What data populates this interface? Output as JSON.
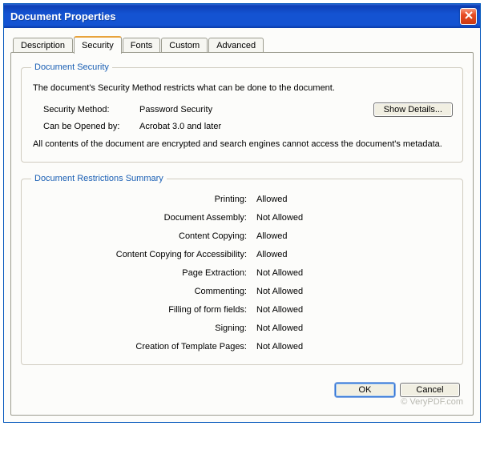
{
  "window": {
    "title": "Document Properties"
  },
  "tabs": {
    "description": "Description",
    "security": "Security",
    "fonts": "Fonts",
    "custom": "Custom",
    "advanced": "Advanced"
  },
  "security": {
    "legend": "Document Security",
    "intro": "The document's Security Method restricts what can be done to the document.",
    "method_label": "Security Method:",
    "method_value": "Password Security",
    "show_details": "Show Details...",
    "opened_label": "Can be Opened by:",
    "opened_value": "Acrobat 3.0 and later",
    "note": "All contents of the document are encrypted and search engines cannot access the document's metadata."
  },
  "restrictions": {
    "legend": "Document Restrictions Summary",
    "items": [
      {
        "label": "Printing:",
        "value": "Allowed"
      },
      {
        "label": "Document Assembly:",
        "value": "Not Allowed"
      },
      {
        "label": "Content Copying:",
        "value": "Allowed"
      },
      {
        "label": "Content Copying for Accessibility:",
        "value": "Allowed"
      },
      {
        "label": "Page Extraction:",
        "value": "Not Allowed"
      },
      {
        "label": "Commenting:",
        "value": "Not Allowed"
      },
      {
        "label": "Filling of form fields:",
        "value": "Not Allowed"
      },
      {
        "label": "Signing:",
        "value": "Not Allowed"
      },
      {
        "label": "Creation of Template Pages:",
        "value": "Not Allowed"
      }
    ]
  },
  "footer": {
    "ok": "OK",
    "cancel": "Cancel"
  },
  "watermark": "© VeryPDF.com"
}
